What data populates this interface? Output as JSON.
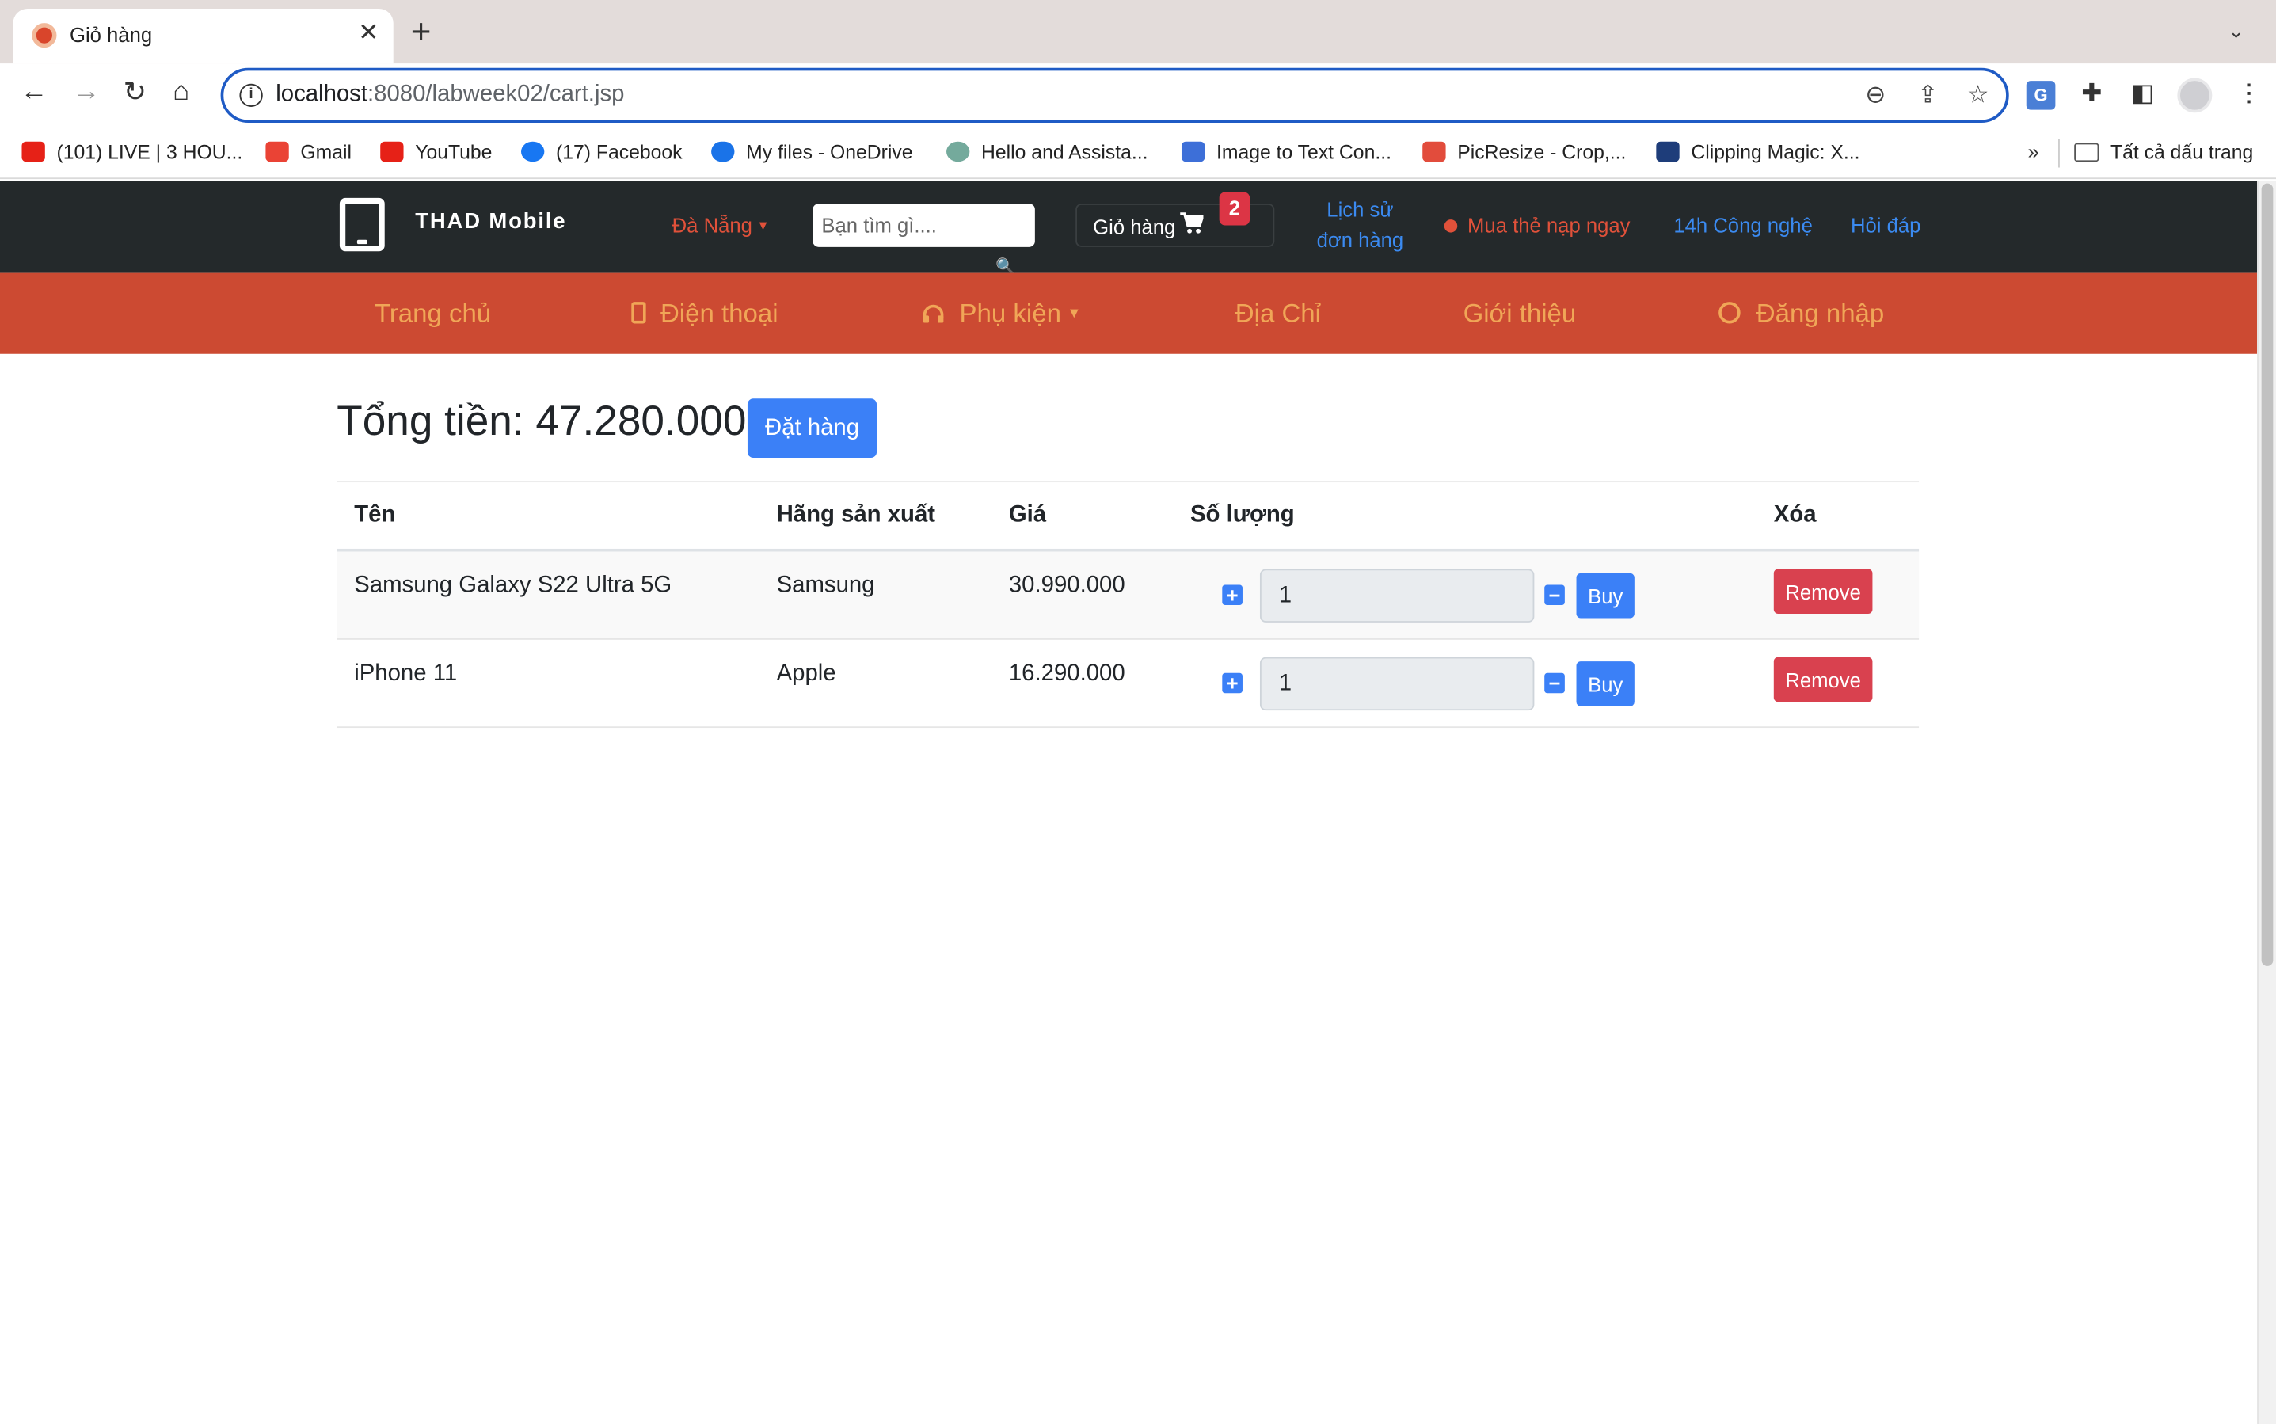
{
  "browser": {
    "tab_title": "Giỏ hàng",
    "url_host": "localhost",
    "url_rest": ":8080/labweek02/cart.jsp",
    "bookmarks": [
      {
        "label": "(101) LIVE | 3 HOU...",
        "icon": "youtube-icon",
        "color": "#e62117"
      },
      {
        "label": "Gmail",
        "icon": "gmail-icon",
        "color": "#ea4335"
      },
      {
        "label": "YouTube",
        "icon": "youtube-icon",
        "color": "#e62117"
      },
      {
        "label": "(17) Facebook",
        "icon": "facebook-icon",
        "color": "#1877f2"
      },
      {
        "label": "My files - OneDrive",
        "icon": "onedrive-icon",
        "color": "#1a73e8"
      },
      {
        "label": "Hello and Assista...",
        "icon": "chatgpt-icon",
        "color": "#74aa9c"
      },
      {
        "label": "Image to Text Con...",
        "icon": "id-card-icon",
        "color": "#3d6fd8"
      },
      {
        "label": "PicResize - Crop,...",
        "icon": "picresize-icon",
        "color": "#e24c3c"
      },
      {
        "label": "Clipping Magic: X...",
        "icon": "clippingmagic-icon",
        "color": "#1e3d7a"
      }
    ],
    "more_bookmarks": "»",
    "all_bookmarks": "Tất cả dấu trang"
  },
  "site": {
    "brand": "THAD Mobile",
    "city": "Đà Nẵng",
    "search_placeholder": "Bạn tìm gì....",
    "cart_label": "Giỏ hàng",
    "cart_count": "2",
    "history_line1": "Lịch sử",
    "history_line2": "đơn hàng",
    "promo": "Mua thẻ nạp ngay",
    "tech": "14h Công nghệ",
    "faq": "Hỏi đáp",
    "nav": {
      "home": "Trang chủ",
      "phones": "Điện thoại",
      "accessories": "Phụ kiện",
      "address": "Địa Chỉ",
      "about": "Giới thiệu",
      "login": "Đăng nhập"
    },
    "accent_colors": {
      "topbar": "#24292b",
      "navbar": "#cc4a32",
      "nav_text": "#f0a657",
      "primary": "#3b80f7",
      "danger": "#d9414f"
    }
  },
  "cart": {
    "total_label": "Tổng tiền: 47.280.000",
    "order_button": "Đặt hàng",
    "columns": {
      "name": "Tên",
      "brand": "Hãng sản xuất",
      "price": "Giá",
      "qty": "Số lượng",
      "delete": "Xóa"
    },
    "items": [
      {
        "name": "Samsung Galaxy S22 Ultra 5G",
        "brand": "Samsung",
        "price": "30.990.000",
        "qty": "1",
        "buy": "Buy",
        "remove": "Remove"
      },
      {
        "name": "iPhone 11",
        "brand": "Apple",
        "price": "16.290.000",
        "qty": "1",
        "buy": "Buy",
        "remove": "Remove"
      }
    ]
  }
}
